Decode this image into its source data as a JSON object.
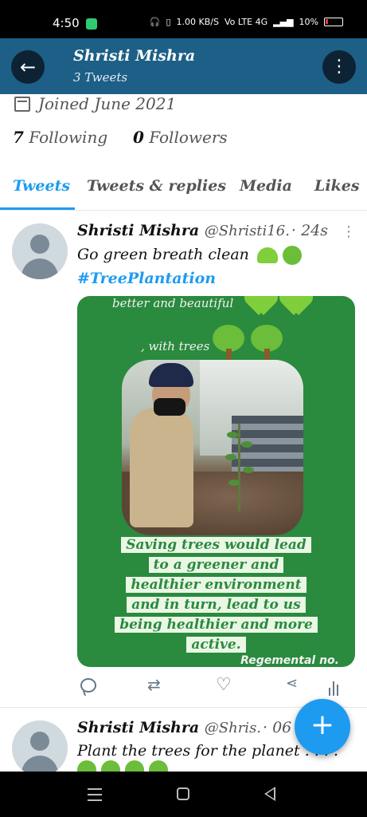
{
  "status_bar": {
    "time": "4:50",
    "speed": "1.00 KB/S",
    "network": "Vo LTE 4G",
    "battery": "10%"
  },
  "header": {
    "title": "Shristi Mishra",
    "subtitle": "3 Tweets",
    "back_icon": "arrow-left-icon",
    "more_icon": "more-vertical-icon",
    "bar_color": "#1d5f86"
  },
  "profile": {
    "joined": "Joined June 2021",
    "following_count": "7",
    "following_label": "Following",
    "followers_count": "0",
    "followers_label": "Followers"
  },
  "tabs": [
    {
      "label": "Tweets",
      "active": true
    },
    {
      "label": "Tweets & replies",
      "active": false
    },
    {
      "label": "Media",
      "active": false
    },
    {
      "label": "Likes",
      "active": false
    }
  ],
  "tweets": [
    {
      "name": "Shristi Mishra",
      "handle": "@Shristi16.",
      "time": "· 24s",
      "text": "Go green breath clean",
      "hashtag": "#TreePlantation",
      "media": {
        "line1": "better and beautiful",
        "line2": ", with trees",
        "quote": [
          "Saving trees would lead",
          "to a greener and",
          "healthier environment",
          "and in turn,  lead to us",
          "being healthier and more",
          "active."
        ],
        "footer": "Regemental no."
      }
    },
    {
      "name": "Shristi Mishra",
      "handle": "@Shris.",
      "time": "· 06",
      "text": "Plant the trees for the planet . . . ."
    }
  ],
  "fab_icon": "plus-icon",
  "accent_color": "#1d9bf0"
}
